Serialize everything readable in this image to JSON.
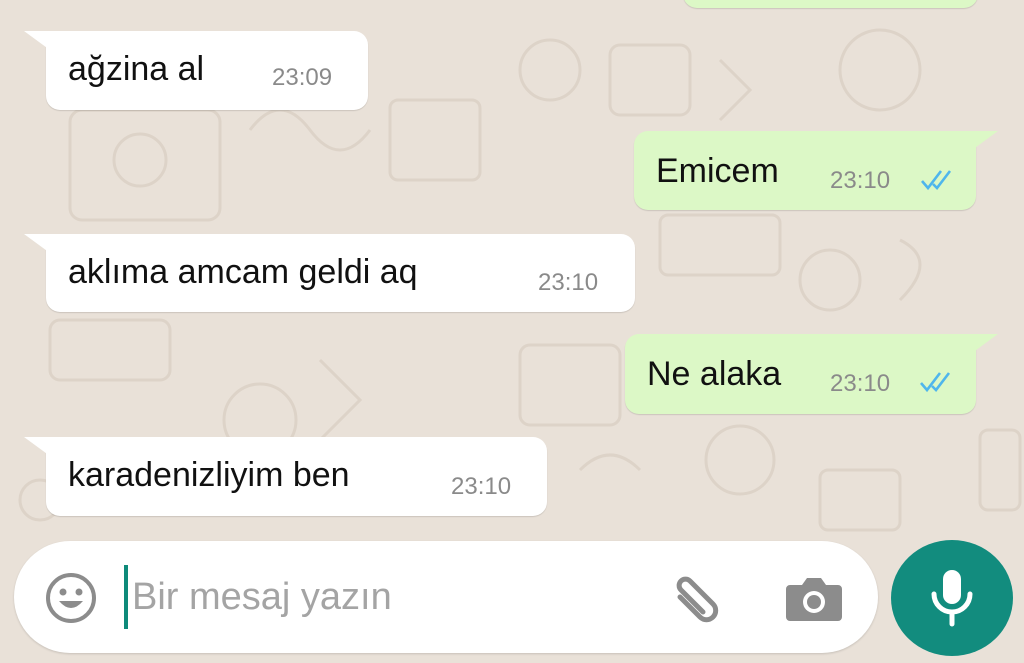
{
  "messages": [
    {
      "direction": "in",
      "text": "ağzina al",
      "time": "23:09"
    },
    {
      "direction": "out",
      "text": "Emicem",
      "time": "23:10",
      "status": "read"
    },
    {
      "direction": "in",
      "text": "aklıma amcam geldi aq",
      "time": "23:10"
    },
    {
      "direction": "out",
      "text": "Ne alaka",
      "time": "23:10",
      "status": "read"
    },
    {
      "direction": "in",
      "text": "karadenizliyim ben",
      "time": "23:10"
    }
  ],
  "composer": {
    "placeholder": "Bir mesaj yazın",
    "emoji_icon": "smiley-icon",
    "attach_icon": "paperclip-icon",
    "camera_icon": "camera-icon",
    "mic_icon": "microphone-icon"
  },
  "colors": {
    "wallpaper": "#e9e1d8",
    "incoming_bubble": "#ffffff",
    "outgoing_bubble": "#dcf8c6",
    "read_ticks": "#4fb6ec",
    "mic_button": "#128c7e"
  }
}
